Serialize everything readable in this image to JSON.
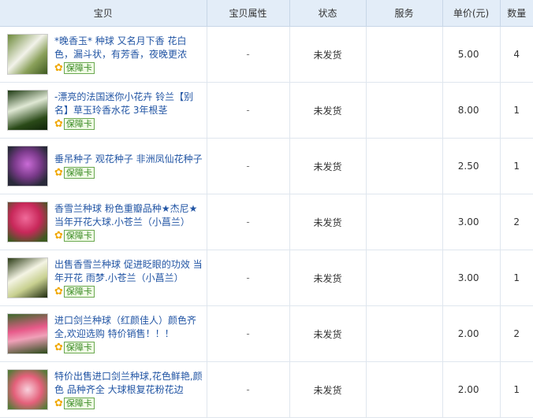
{
  "headers": {
    "item": "宝贝",
    "attrs": "宝贝属性",
    "status": "状态",
    "service": "服务",
    "price": "单价(元)",
    "qty": "数量"
  },
  "badge_label": "保障卡",
  "rows": [
    {
      "title": "*晚香玉* 种球 又名月下香 花白色，漏斗状，有芳香，夜晚更浓",
      "attr": "-",
      "status": "未发货",
      "service": "",
      "price": "5.00",
      "qty": "4"
    },
    {
      "title": "-漂亮的法国迷你小花卉 铃兰【别名】草玉玲香水花 3年根茎",
      "attr": "-",
      "status": "未发货",
      "service": "",
      "price": "8.00",
      "qty": "1"
    },
    {
      "title": "垂吊种子 观花种子 非洲凤仙花种子",
      "attr": "-",
      "status": "未发货",
      "service": "",
      "price": "2.50",
      "qty": "1"
    },
    {
      "title": "香雪兰种球 粉色重瓣品种★杰尼★当年开花大球.小苍兰（小菖兰）",
      "attr": "-",
      "status": "未发货",
      "service": "",
      "price": "3.00",
      "qty": "2"
    },
    {
      "title": "出售香雪兰种球 促进眨眼的功效 当年开花 雨梦.小苍兰（小菖兰）",
      "attr": "-",
      "status": "未发货",
      "service": "",
      "price": "3.00",
      "qty": "1"
    },
    {
      "title": "进口剑兰种球（红颜佳人）颜色齐全,欢迎选购 特价销售！！！",
      "attr": "-",
      "status": "未发货",
      "service": "",
      "price": "2.00",
      "qty": "2"
    },
    {
      "title": "特价出售进口剑兰种球,花色鲜艳,颜色 品种齐全 大球根复花粉花边",
      "attr": "-",
      "status": "未发货",
      "service": "",
      "price": "2.00",
      "qty": "1"
    }
  ],
  "colors": {
    "header_bg": "#e3edf8",
    "link": "#2255a4",
    "border": "#dfe6ee"
  }
}
